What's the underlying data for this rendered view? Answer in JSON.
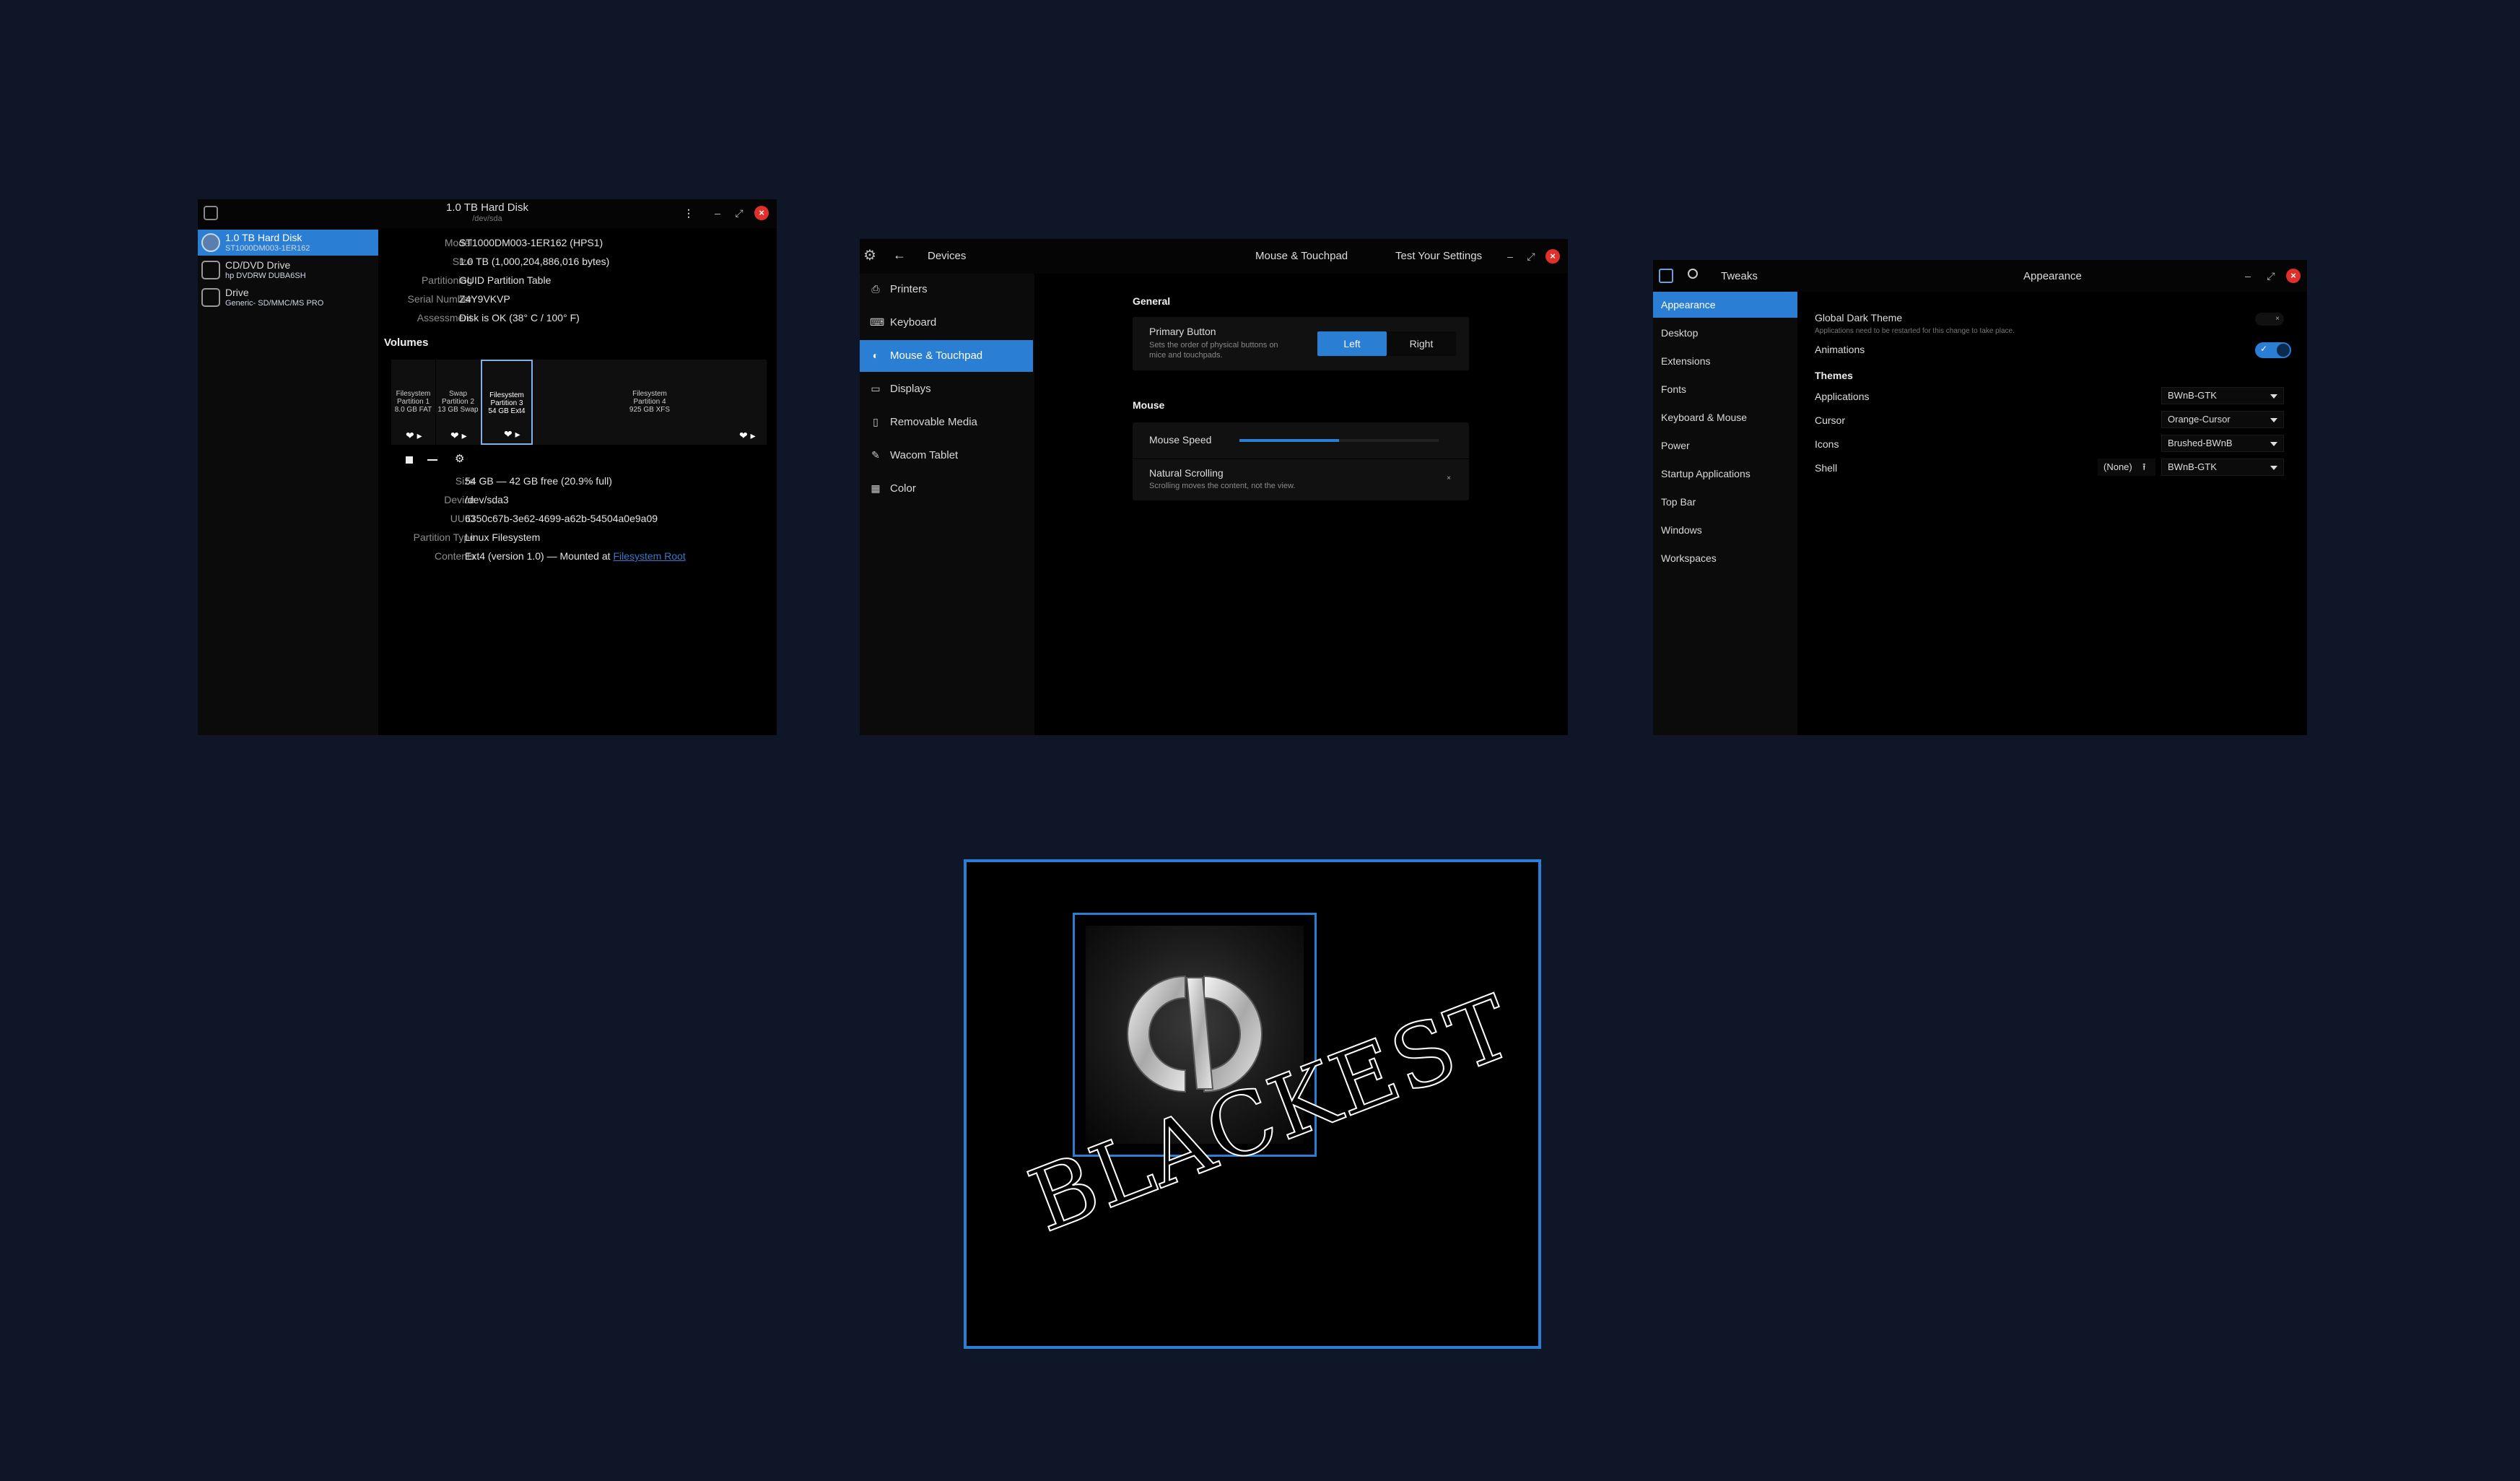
{
  "colors": {
    "desktop": "#0e1628",
    "accent": "#2a7fd4",
    "close": "#e0302a",
    "window": "#000000"
  },
  "disks": {
    "title": "1.0 TB Hard Disk",
    "subtitle": "/dev/sda",
    "drives": [
      {
        "name": "1.0 TB Hard Disk",
        "detail": "ST1000DM003-1ER162",
        "icon": "hard-disk-icon"
      },
      {
        "name": "CD/DVD Drive",
        "detail": "hp    DVDRW  DUBA6SH",
        "icon": "optical-drive-icon"
      },
      {
        "name": "Drive",
        "detail": "Generic- SD/MMC/MS PRO",
        "icon": "usb-drive-icon"
      }
    ],
    "info": [
      {
        "label": "Model",
        "value": "ST1000DM003-1ER162 (HPS1)"
      },
      {
        "label": "Size",
        "value": "1.0 TB (1,000,204,886,016 bytes)"
      },
      {
        "label": "Partitioning",
        "value": "GUID Partition Table"
      },
      {
        "label": "Serial Number",
        "value": "Z4Y9VKVP"
      },
      {
        "label": "Assessment",
        "value": "Disk is OK (38° C / 100° F)"
      }
    ],
    "volumes_heading": "Volumes",
    "volumes": [
      {
        "l1": "Filesystem",
        "l2": "Partition 1",
        "l3": "8.0 GB FAT"
      },
      {
        "l1": "Swap",
        "l2": "Partition 2",
        "l3": "13 GB Swap"
      },
      {
        "l1": "Filesystem",
        "l2": "Partition 3",
        "l3": "54 GB Ext4"
      },
      {
        "l1": "Filesystem",
        "l2": "Partition 4",
        "l3": "925 GB XFS"
      }
    ],
    "partition": [
      {
        "label": "Size",
        "value": "54 GB — 42 GB free (20.9% full)"
      },
      {
        "label": "Device",
        "value": "/dev/sda3"
      },
      {
        "label": "UUID",
        "value": "6350c67b-3e62-4699-a62b-54504a0e9a09"
      },
      {
        "label": "Partition Type",
        "value": "Linux Filesystem"
      },
      {
        "label": "Contents",
        "value": "Ext4 (version 1.0) — Mounted at ",
        "link": "Filesystem Root"
      }
    ]
  },
  "settings": {
    "panel_title": "Devices",
    "title": "Mouse & Touchpad",
    "test_button": "Test Your Settings",
    "nav": [
      {
        "label": "Printers",
        "icon": "printer-icon",
        "glyph": "⎙"
      },
      {
        "label": "Keyboard",
        "icon": "keyboard-icon",
        "glyph": "⌨"
      },
      {
        "label": "Mouse & Touchpad",
        "icon": "mouse-icon",
        "glyph": "◐"
      },
      {
        "label": "Displays",
        "icon": "display-icon",
        "glyph": "▭"
      },
      {
        "label": "Removable Media",
        "icon": "removable-media-icon",
        "glyph": "▯"
      },
      {
        "label": "Wacom Tablet",
        "icon": "tablet-icon",
        "glyph": "✎"
      },
      {
        "label": "Color",
        "icon": "color-icon",
        "glyph": "▦"
      }
    ],
    "general_heading": "General",
    "primary_button_label": "Primary Button",
    "primary_button_desc1": "Sets the order of physical buttons on",
    "primary_button_desc2": "mice and touchpads.",
    "left": "Left",
    "right": "Right",
    "mouse_heading": "Mouse",
    "mouse_speed": "Mouse Speed",
    "mouse_speed_value": 0.5,
    "natural_scrolling": "Natural Scrolling",
    "natural_scrolling_desc": "Scrolling moves the content, not the view."
  },
  "tweaks": {
    "app_name": "Tweaks",
    "title": "Appearance",
    "nav": [
      "Appearance",
      "Desktop",
      "Extensions",
      "Fonts",
      "Keyboard & Mouse",
      "Power",
      "Startup Applications",
      "Top Bar",
      "Windows",
      "Workspaces"
    ],
    "global_dark_theme": "Global Dark Theme",
    "global_dark_desc": "Applications need to be restarted for this change to take place.",
    "animations": "Animations",
    "themes_heading": "Themes",
    "themes": [
      {
        "label": "Applications",
        "value": "BWnB-GTK"
      },
      {
        "label": "Cursor",
        "value": "Orange-Cursor"
      },
      {
        "label": "Icons",
        "value": "Brushed-BWnB"
      },
      {
        "label": "Shell",
        "value": "BWnB-GTK"
      }
    ],
    "shell_none": "(None)"
  },
  "wallpaper": {
    "text": "BLACKEST"
  }
}
